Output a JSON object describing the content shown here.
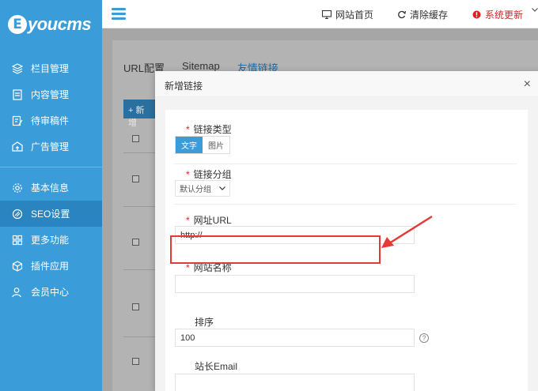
{
  "brand": {
    "logo_mark": "E",
    "logo_text": "youcms"
  },
  "sidebar": {
    "items": [
      {
        "label": "栏目管理",
        "icon": "layers-icon"
      },
      {
        "label": "内容管理",
        "icon": "document-icon"
      },
      {
        "label": "待审稿件",
        "icon": "edit-doc-icon"
      },
      {
        "label": "广告管理",
        "icon": "ad-icon"
      },
      {
        "label": "基本信息",
        "icon": "gear-icon"
      },
      {
        "label": "SEO设置",
        "icon": "seo-icon",
        "active": true
      },
      {
        "label": "更多功能",
        "icon": "grid-icon"
      },
      {
        "label": "插件应用",
        "icon": "cube-icon"
      },
      {
        "label": "会员中心",
        "icon": "user-icon"
      }
    ]
  },
  "topbar": {
    "home_label": "网站首页",
    "clear_cache_label": "清除缓存",
    "update_label": "系统更新",
    "update_color": "#e02020"
  },
  "page": {
    "tabs": [
      "URL配置",
      "Sitemap",
      "友情链接"
    ],
    "add_label": "+ 新增"
  },
  "modal": {
    "title": "新增链接",
    "close": "×",
    "fields": {
      "link_type": {
        "label": "链接类型",
        "options": [
          "文字",
          "图片"
        ],
        "selected": "文字"
      },
      "link_group": {
        "label": "链接分组",
        "value": "默认分组"
      },
      "url": {
        "label": "网址URL",
        "value": "http://"
      },
      "site_name": {
        "label": "网站名称",
        "value": ""
      },
      "sort": {
        "label": "排序",
        "value": "100",
        "help": "?"
      },
      "email": {
        "label": "站长Email",
        "value": ""
      }
    }
  },
  "colors": {
    "sidebar": "#3a9cd8",
    "accent": "#3a9cd8",
    "annotation": "#e53935"
  }
}
